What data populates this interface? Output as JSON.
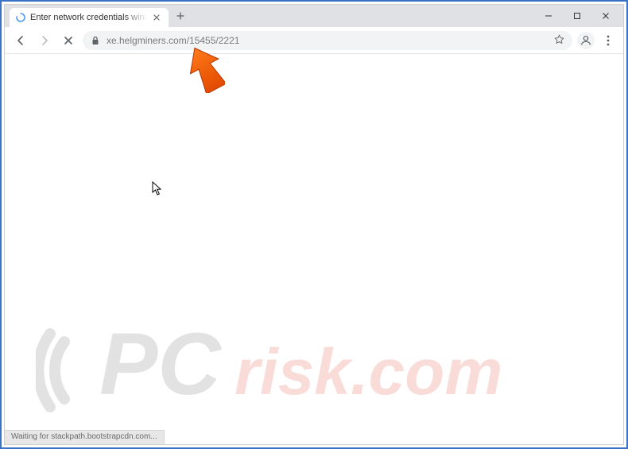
{
  "window": {
    "tab_title": "Enter network credentials windo",
    "new_tab_label": "+",
    "minimize": "–",
    "maximize": "□",
    "close": "×"
  },
  "toolbar": {
    "back_icon": "back",
    "forward_icon": "forward",
    "stop_icon": "stop",
    "url": "xe.helgminers.com/15455/2221",
    "star_icon": "star",
    "avatar_icon": "person",
    "menu_icon": "menu"
  },
  "status": {
    "text": "Waiting for stackpath.bootstrapcdn.com..."
  },
  "overlay": {
    "pointer_arrow": "arrow",
    "cursor": "cursor"
  },
  "watermark": {
    "brand_left": "PC",
    "brand_right": "risk.com"
  }
}
